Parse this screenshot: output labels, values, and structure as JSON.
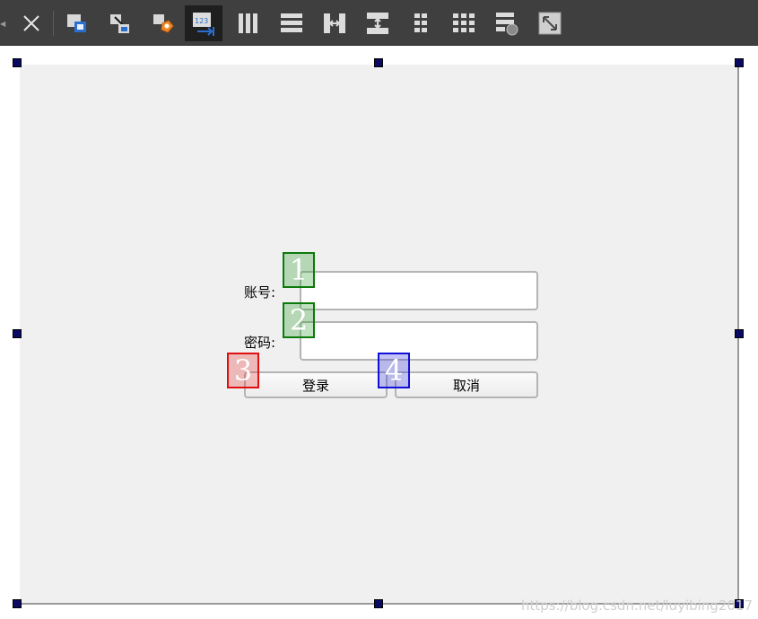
{
  "toolbar": {
    "buttons": [
      {
        "name": "close",
        "icon": "close-icon"
      },
      {
        "name": "edit-widgets",
        "icon": "edit-widgets-icon"
      },
      {
        "name": "edit-signals-slots",
        "icon": "edit-signals-slots-icon"
      },
      {
        "name": "edit-buddies",
        "icon": "edit-buddies-icon"
      },
      {
        "name": "edit-tab-order",
        "icon": "edit-tab-order-icon",
        "active": true
      },
      {
        "name": "layout-horizontal",
        "icon": "layout-horizontal-icon"
      },
      {
        "name": "layout-vertical",
        "icon": "layout-vertical-icon"
      },
      {
        "name": "layout-h-splitter",
        "icon": "splitter-horizontal-icon"
      },
      {
        "name": "layout-v-splitter",
        "icon": "splitter-vertical-icon"
      },
      {
        "name": "layout-form",
        "icon": "layout-form-icon"
      },
      {
        "name": "layout-grid",
        "icon": "layout-grid-icon"
      },
      {
        "name": "break-layout",
        "icon": "break-layout-icon"
      },
      {
        "name": "adjust-size",
        "icon": "adjust-size-icon"
      }
    ],
    "tab_order_label": "123"
  },
  "form": {
    "account_label": "账号:",
    "password_label": "密码:",
    "login_button": "登录",
    "cancel_button": "取消"
  },
  "tab_order": {
    "marker_1": "1",
    "marker_2": "2",
    "marker_3": "3",
    "marker_4": "4"
  },
  "colors": {
    "toolbar_bg": "#3f3f3f",
    "form_bg": "#f0f0f0",
    "marker_green": "#0b7a0b",
    "marker_red": "#e01010",
    "marker_blue": "#1010d8",
    "handle": "#0a0a63"
  },
  "watermark": "https://blog.csdn.net/luyibing2017"
}
